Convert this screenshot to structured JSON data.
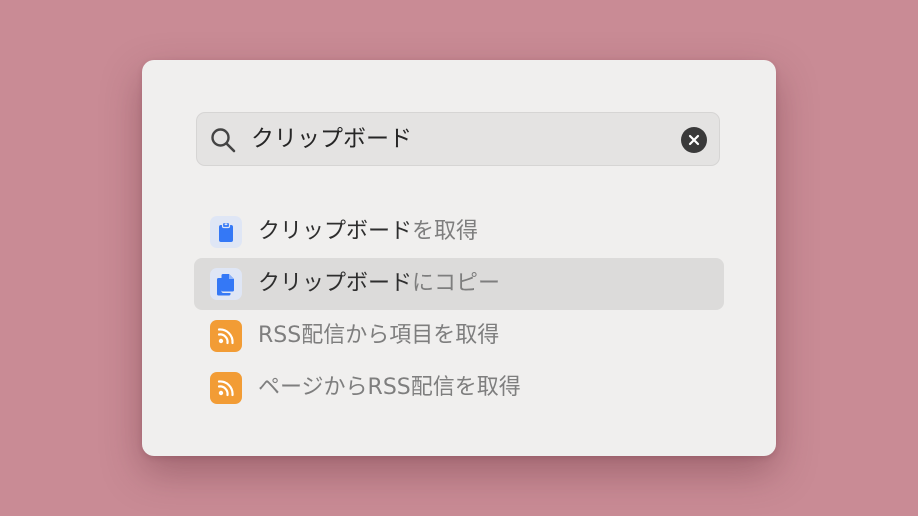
{
  "search": {
    "query": "クリップボード",
    "icon": "search-icon",
    "clear_icon": "clear-icon"
  },
  "results": [
    {
      "match": "クリップボード",
      "rest": "を取得",
      "icon": "clipboard-icon",
      "selected": false
    },
    {
      "match": "クリップボード",
      "rest": "にコピー",
      "icon": "copy-documents-icon",
      "selected": true
    },
    {
      "match": "",
      "rest": "RSS配信から項目を取得",
      "icon": "rss-icon",
      "selected": false
    },
    {
      "match": "",
      "rest": "ページからRSS配信を取得",
      "icon": "rss-icon",
      "selected": false
    }
  ],
  "colors": {
    "background": "#c98b95",
    "panel": "#f0efee",
    "clipboard_accent": "#3478f6",
    "rss_accent": "#f29c35"
  }
}
